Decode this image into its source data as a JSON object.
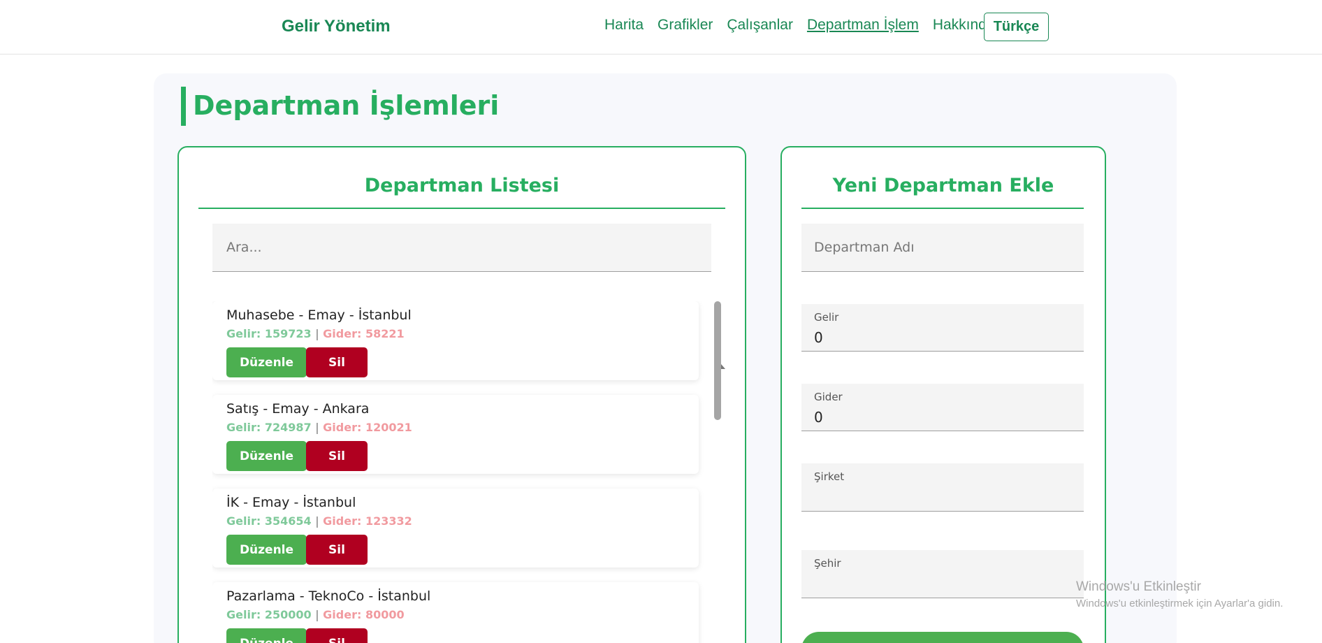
{
  "navbar": {
    "brand": "Gelir Yönetim",
    "links": [
      "Harita",
      "Grafikler",
      "Çalışanlar",
      "Departman İşlem",
      "Hakkında"
    ],
    "language": "Türkçe"
  },
  "page": {
    "title": "Departman İşlemleri"
  },
  "list_panel": {
    "title": "Departman Listesi",
    "search_placeholder": "Ara...",
    "items": [
      {
        "name": "Muhasebe - Emay - İstanbul",
        "gelir": "Gelir: 159723",
        "gider": "Gider: 58221"
      },
      {
        "name": "Satış - Emay - Ankara",
        "gelir": "Gelir: 724987",
        "gider": "Gider: 120021"
      },
      {
        "name": "İK - Emay - İstanbul",
        "gelir": "Gelir: 354654",
        "gider": "Gider: 123332"
      },
      {
        "name": "Pazarlama - TeknoCo - İstanbul",
        "gelir": "Gelir: 250000",
        "gider": "Gider: 80000"
      }
    ],
    "separator": "|",
    "edit_label": "Düzenle",
    "delete_label": "Sil"
  },
  "form_panel": {
    "title": "Yeni Departman Ekle",
    "name_placeholder": "Departman Adı",
    "gelir_label": "Gelir",
    "gelir_value": "0",
    "gider_label": "Gider",
    "gider_value": "0",
    "sirket_label": "Şirket",
    "sehir_label": "Şehir"
  },
  "watermark": {
    "title": "Windows'u Etkinleştir",
    "subtitle": "Windows'u etkinleştirmek için Ayarlar'a gidin."
  },
  "colors": {
    "accent": "#27ae60",
    "brand": "#198754",
    "edit": "#4caf50",
    "delete": "#b00020"
  }
}
